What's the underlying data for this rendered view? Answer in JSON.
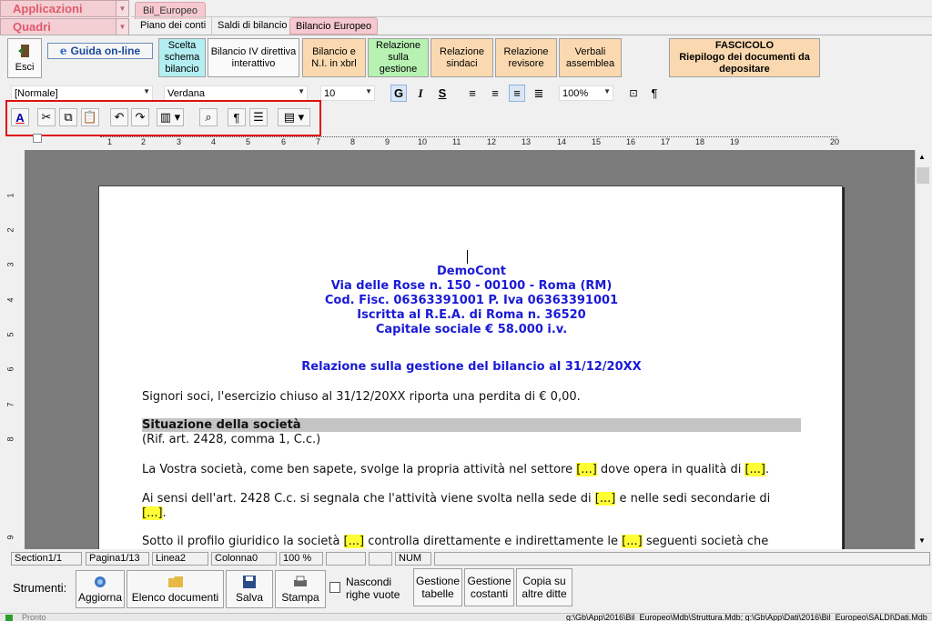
{
  "top": {
    "applicazioni": "Applicazioni",
    "quadri": "Quadri",
    "bil_tab": "Bil_Europeo",
    "subtabs": [
      "Piano dei conti",
      "Saldi di bilancio",
      "Bilancio Europeo"
    ]
  },
  "toolbar": {
    "esci": "Esci",
    "guida": "Guida on-line",
    "buttons": [
      "Scelta schema bilancio",
      "Bilancio IV direttiva interattivo",
      "Bilancio e N.I. in xbrl",
      "Relazione sulla gestione",
      "Relazione sindaci",
      "Relazione revisore",
      "Verbali assemblea"
    ],
    "fascicolo_title": "FASCICOLO",
    "fascicolo_sub": "Riepilogo dei documenti da depositare"
  },
  "format": {
    "style": "[Normale]",
    "font": "Verdana",
    "size": "10",
    "zoom": "100%",
    "bold": "G",
    "italic": "I",
    "underline": "S"
  },
  "ruler": {
    "h_ticks": [
      "1",
      "2",
      "3",
      "4",
      "5",
      "6",
      "7",
      "8",
      "9",
      "10",
      "11",
      "12",
      "13",
      "14",
      "15",
      "16",
      "17",
      "18",
      "19",
      "20"
    ],
    "v_ticks": [
      "1",
      "2",
      "3",
      "4",
      "5",
      "6",
      "7",
      "8",
      "9"
    ]
  },
  "document": {
    "company": "DemoCont",
    "address": "Via delle Rose n. 150 - 00100 - Roma (RM)",
    "codfisc": "Cod. Fisc. 06363391001 P. Iva 06363391001",
    "rea": "Iscritta al R.E.A. di Roma n. 36520",
    "capitale": "Capitale sociale € 58.000 i.v.",
    "title": "Relazione sulla gestione del bilancio al 31/12/20XX",
    "p1": "Signori soci, l'esercizio chiuso al 31/12/20XX riporta una perdita di € 0,00.",
    "section": "Situazione della società",
    "rif": "(Rif. art. 2428, comma 1, C.c.)",
    "p2a": "La Vostra società, come ben sapete, svolge la propria attività nel settore ",
    "p2b": " dove opera in qualità di ",
    "p3a": "Ai sensi dell'art. 2428 C.c. si segnala che l'attività viene svolta nella sede di ",
    "p3b": " e nelle sedi secondarie di",
    "p4a": "Sotto il profilo giuridico la società ",
    "p4b": " controlla direttamente e indirettamente le ",
    "p4c": " seguenti società che",
    "placeholder": "[...]"
  },
  "status": {
    "section": "Section1/1",
    "page": "Pagina1/13",
    "line": "Linea2",
    "column": "Colonna0",
    "zoom": "100 %",
    "num": "NUM"
  },
  "bottom": {
    "strumenti": "Strumenti:",
    "aggiorna": "Aggiorna",
    "elenco": "Elenco documenti",
    "salva": "Salva",
    "stampa": "Stampa",
    "nascondi": "Nascondi righe vuote",
    "gestione_tabelle": "Gestione tabelle",
    "gestione_costanti": "Gestione costanti",
    "copia": "Copia su altre ditte",
    "pronto": "Pronto",
    "path": "g:\\Gb\\App\\2016\\Bil_Europeo\\Mdb\\Struttura.Mdb; g:\\Gb\\App\\Dati\\2016\\Bil_Europeo\\SALDI\\Dati.Mdb"
  }
}
